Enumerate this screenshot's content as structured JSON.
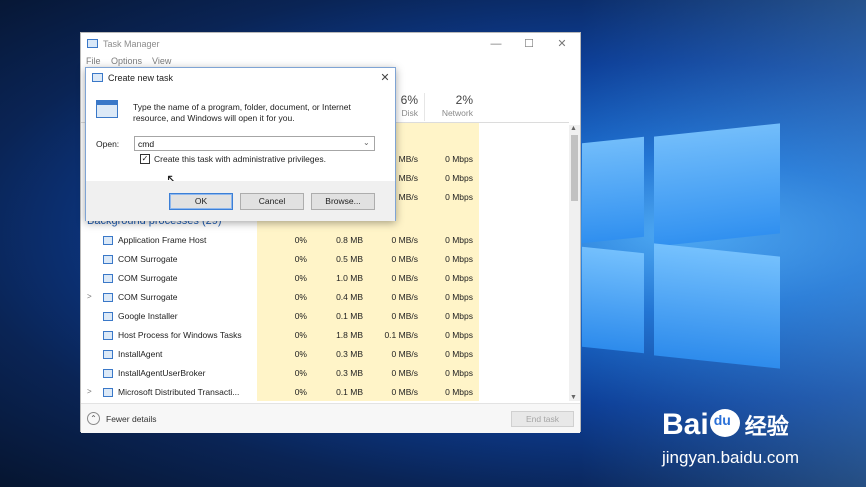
{
  "taskmanager": {
    "title": "Task Manager",
    "menu": [
      "File",
      "Options",
      "View"
    ],
    "columns": {
      "disk": {
        "pct": "6%",
        "name": "Disk"
      },
      "network": {
        "pct": "2%",
        "name": "Network"
      }
    },
    "partial_rows": [
      {
        "disk": "MB/s",
        "network": "0 Mbps"
      },
      {
        "disk": "MB/s",
        "network": "0 Mbps"
      },
      {
        "disk": "MB/s",
        "network": "0 Mbps"
      }
    ],
    "group_heading": "Background processes (29)",
    "processes": [
      {
        "expand": "",
        "name": "Application Frame Host",
        "cpu": "0%",
        "memory": "0.8 MB",
        "disk": "0 MB/s",
        "network": "0 Mbps"
      },
      {
        "expand": "",
        "name": "COM Surrogate",
        "cpu": "0%",
        "memory": "0.5 MB",
        "disk": "0 MB/s",
        "network": "0 Mbps"
      },
      {
        "expand": "",
        "name": "COM Surrogate",
        "cpu": "0%",
        "memory": "1.0 MB",
        "disk": "0 MB/s",
        "network": "0 Mbps"
      },
      {
        "expand": ">",
        "name": "COM Surrogate",
        "cpu": "0%",
        "memory": "0.4 MB",
        "disk": "0 MB/s",
        "network": "0 Mbps"
      },
      {
        "expand": "",
        "name": "Google Installer",
        "cpu": "0%",
        "memory": "0.1 MB",
        "disk": "0 MB/s",
        "network": "0 Mbps"
      },
      {
        "expand": "",
        "name": "Host Process for Windows Tasks",
        "cpu": "0%",
        "memory": "1.8 MB",
        "disk": "0.1 MB/s",
        "network": "0 Mbps"
      },
      {
        "expand": "",
        "name": "InstallAgent",
        "cpu": "0%",
        "memory": "0.3 MB",
        "disk": "0 MB/s",
        "network": "0 Mbps"
      },
      {
        "expand": "",
        "name": "InstallAgentUserBroker",
        "cpu": "0%",
        "memory": "0.3 MB",
        "disk": "0 MB/s",
        "network": "0 Mbps"
      },
      {
        "expand": ">",
        "name": "Microsoft Distributed Transacti...",
        "cpu": "0%",
        "memory": "0.1 MB",
        "disk": "0 MB/s",
        "network": "0 Mbps"
      }
    ],
    "footer": {
      "fewer_details": "Fewer details",
      "end_task": "End task"
    }
  },
  "dialog": {
    "title": "Create new task",
    "message": "Type the name of a program, folder, document, or Internet resource, and Windows will open it for you.",
    "open_label": "Open:",
    "open_value": "cmd",
    "admin_checkbox_label": "Create this task with administrative privileges.",
    "admin_checked": true,
    "buttons": {
      "ok": "OK",
      "cancel": "Cancel",
      "browse": "Browse..."
    }
  },
  "watermark": {
    "logo_left": "Bai",
    "logo_right": "经验",
    "url": "jingyan.baidu.com"
  }
}
